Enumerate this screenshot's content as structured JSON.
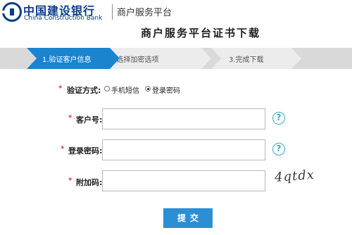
{
  "header": {
    "brand_cn": "中国建设银行",
    "brand_en": "China Construction Bank",
    "platform_name": "商户服务平台",
    "brand_color": "#0a3d86"
  },
  "page_title": "商户服务平台证书下载",
  "steps": [
    {
      "label": "1.验证客户信息",
      "active": true
    },
    {
      "label": "2.选择加密选项",
      "active": false
    },
    {
      "label": "3.完成下载",
      "active": false
    }
  ],
  "form": {
    "required_mark": "*",
    "verify_method": {
      "label": "验证方式:",
      "options": [
        {
          "label": "手机短信",
          "checked": false
        },
        {
          "label": "登录密码",
          "checked": true
        }
      ]
    },
    "customer_id": {
      "label": "客户号:",
      "value": ""
    },
    "login_password": {
      "label": "登录密码:",
      "value": ""
    },
    "extra_code": {
      "label": "附加码:",
      "value": ""
    },
    "help_icon_text": "?",
    "captcha_text": "4qtdx",
    "submit_label": "提交"
  },
  "colors": {
    "active_step": "#1a84cf",
    "required": "#cc0000",
    "help_icon": "#3ba8c4",
    "submit": "#2c8fd3"
  }
}
